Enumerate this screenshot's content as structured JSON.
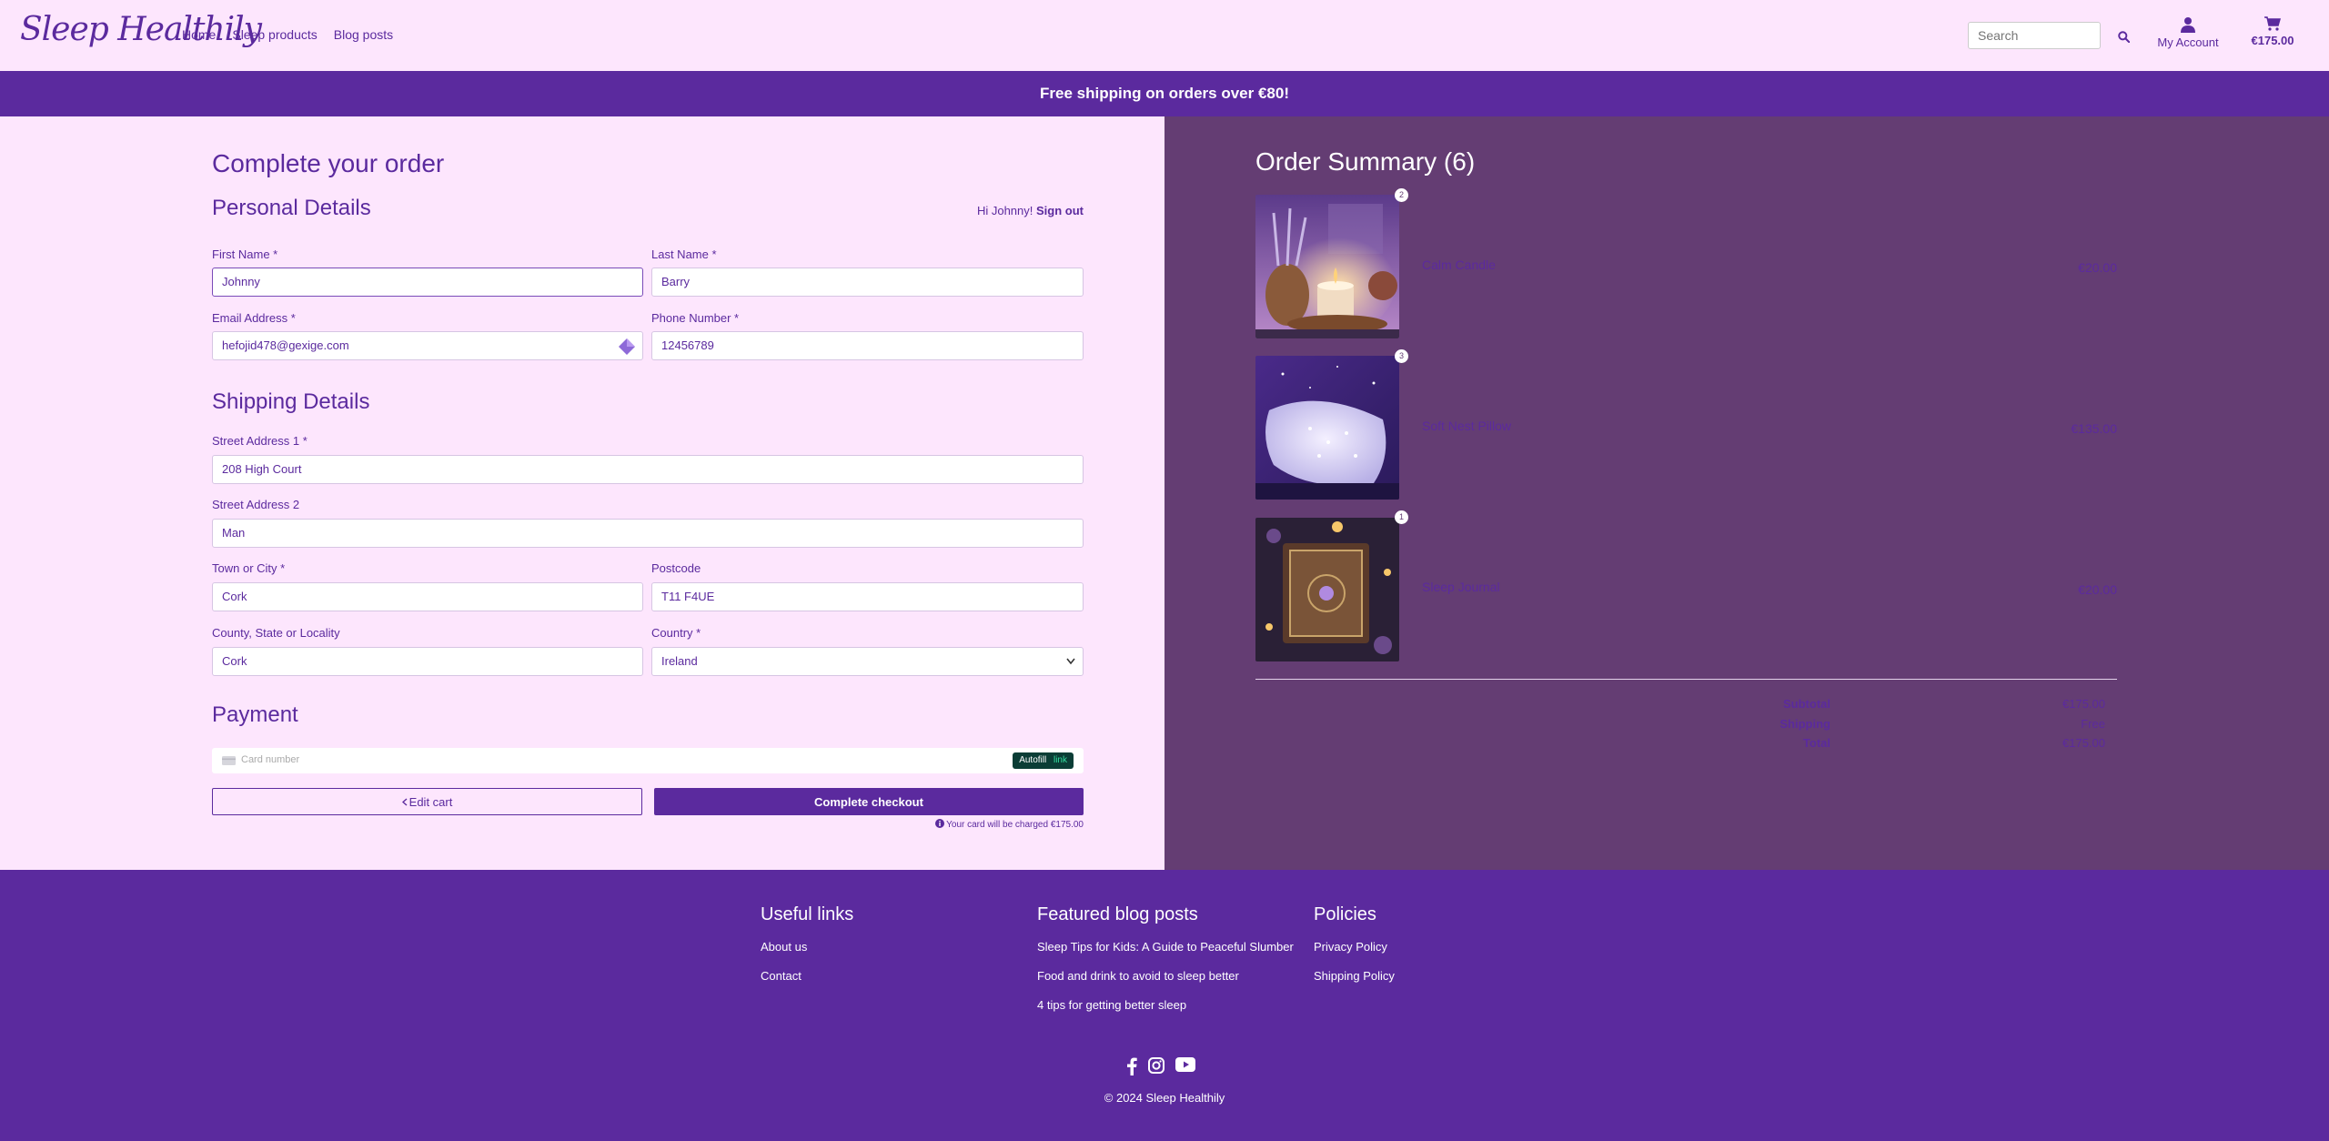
{
  "header": {
    "logo": "Sleep Healthily",
    "nav": [
      "Home",
      "Sleep products",
      "Blog posts"
    ],
    "search_placeholder": "Search",
    "account_label": "My Account",
    "cart_total": "€175.00"
  },
  "banner": {
    "text": "Free shipping on orders over €80!"
  },
  "checkout": {
    "title": "Complete your order",
    "personal_title": "Personal Details",
    "greeting": "Hi Johnny!",
    "sign_out": "Sign out",
    "first_name_label": "First Name *",
    "first_name": "Johnny",
    "last_name_label": "Last Name *",
    "last_name": "Barry",
    "email_label": "Email Address *",
    "email": "hefojid478@gexige.com",
    "phone_label": "Phone Number *",
    "phone": "12456789",
    "shipping_title": "Shipping Details",
    "street1_label": "Street Address 1 *",
    "street1": "208 High Court",
    "street2_label": "Street Address 2",
    "street2": "Man",
    "town_label": "Town or City *",
    "town": "Cork",
    "postcode_label": "Postcode",
    "postcode": "T11 F4UE",
    "county_label": "County, State or Locality",
    "county": "Cork",
    "country_label": "Country *",
    "country": "Ireland",
    "payment_title": "Payment",
    "card_placeholder": "Card number",
    "autofill_label": "Autofill",
    "autofill_brand": "link",
    "edit_cart": "Edit cart",
    "complete_checkout": "Complete checkout",
    "charge_note": "Your card will be charged €175.00"
  },
  "summary": {
    "title": "Order Summary (6)",
    "items": [
      {
        "name": "Calm Candle",
        "qty": "2",
        "price": "€20.00"
      },
      {
        "name": "Soft Nest Pillow",
        "qty": "3",
        "price": "€135.00"
      },
      {
        "name": "Sleep Journal",
        "qty": "1",
        "price": "€20.00"
      }
    ],
    "subtotal_label": "Subtotal",
    "subtotal": "€175.00",
    "shipping_label": "Shipping",
    "shipping": "Free",
    "total_label": "Total",
    "total": "€175.00"
  },
  "footer": {
    "useful_title": "Useful links",
    "useful_links": [
      "About us",
      "Contact"
    ],
    "blog_title": "Featured blog posts",
    "blog_links": [
      "Sleep Tips for Kids: A Guide to Peaceful Slumber",
      "Food and drink to avoid to sleep better",
      "4 tips for getting better sleep"
    ],
    "policies_title": "Policies",
    "policy_links": [
      "Privacy Policy",
      "Shipping Policy"
    ],
    "copyright": "© 2024 Sleep Healthily"
  },
  "colors": {
    "brand": "#5b2a9e",
    "background": "#fde6fd",
    "summary_bg": "#643d73"
  },
  "icons": [
    "search-icon",
    "user-icon",
    "cart-icon",
    "chevron-left-icon",
    "info-icon",
    "card-icon",
    "facebook-icon",
    "instagram-icon",
    "youtube-icon"
  ]
}
